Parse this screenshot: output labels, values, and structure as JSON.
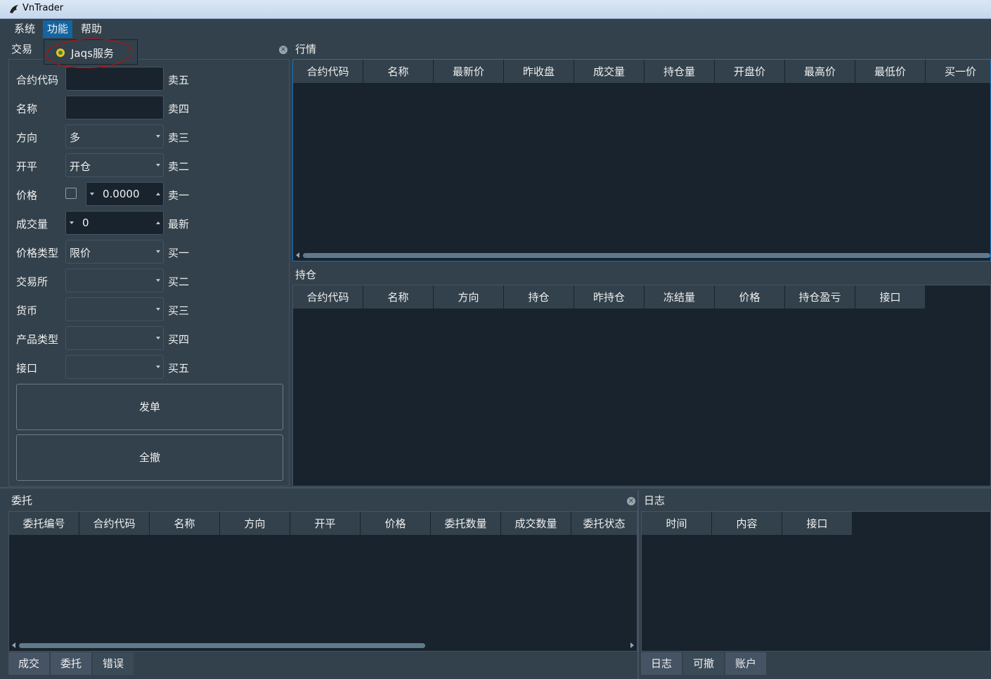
{
  "window": {
    "title": "VnTrader"
  },
  "menu": {
    "items": [
      "系统",
      "功能",
      "帮助"
    ],
    "active_index": 1
  },
  "dropdown": {
    "items": [
      {
        "label": "Jaqs服务",
        "icon": "jaqs-service-icon"
      }
    ]
  },
  "docks": {
    "trading": {
      "title": "交易"
    },
    "market": {
      "title": "行情"
    },
    "position": {
      "title": "持仓"
    },
    "orders": {
      "title": "委托"
    },
    "log": {
      "title": "日志"
    }
  },
  "trading_form": {
    "symbol_label": "合约代码",
    "name_label": "名称",
    "direction_label": "方向",
    "direction_value": "多",
    "offset_label": "开平",
    "offset_value": "开仓",
    "price_label": "价格",
    "price_value": "0.0000",
    "price_checked": false,
    "volume_label": "成交量",
    "volume_value": "0",
    "price_type_label": "价格类型",
    "price_type_value": "限价",
    "exchange_label": "交易所",
    "currency_label": "货币",
    "product_label": "产品类型",
    "gateway_label": "接口",
    "send_button": "发单",
    "cancel_all_button": "全撤",
    "depth_labels": [
      "卖五",
      "卖四",
      "卖三",
      "卖二",
      "卖一",
      "最新",
      "买一",
      "买二",
      "买三",
      "买四",
      "买五"
    ]
  },
  "market_table": {
    "columns": [
      "合约代码",
      "名称",
      "最新价",
      "昨收盘",
      "成交量",
      "持仓量",
      "开盘价",
      "最高价",
      "最低价",
      "买一价"
    ]
  },
  "position_table": {
    "columns": [
      "合约代码",
      "名称",
      "方向",
      "持仓",
      "昨持仓",
      "冻结量",
      "价格",
      "持仓盈亏",
      "接口"
    ]
  },
  "order_table": {
    "columns": [
      "委托编号",
      "合约代码",
      "名称",
      "方向",
      "开平",
      "价格",
      "委托数量",
      "成交数量",
      "委托状态"
    ]
  },
  "order_tabs": {
    "items": [
      "成交",
      "委托",
      "错误"
    ],
    "selected_index": 2
  },
  "log_table": {
    "columns": [
      "时间",
      "内容",
      "接口"
    ]
  },
  "log_tabs": {
    "items": [
      "日志",
      "可撤",
      "账户"
    ],
    "selected_index": 1
  }
}
